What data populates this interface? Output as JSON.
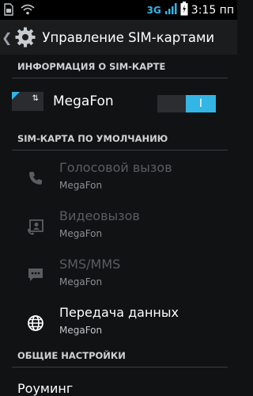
{
  "status_bar": {
    "network_label": "3G",
    "time": "3:15 пп",
    "icons": [
      "sim-icon",
      "wifi-icon",
      "signal-icon",
      "battery-icon"
    ]
  },
  "action_bar": {
    "title": "Управление SIM-картами",
    "icons": [
      "back-caret-icon",
      "gear-icon"
    ]
  },
  "sim_info": {
    "header": "ИНФОРМАЦИЯ О SIM-КАРТЕ",
    "sim_name": "MegaFon",
    "toggle_label": "I",
    "toggle_state": "on"
  },
  "default_sim": {
    "header": "SIM-КАРТА ПО УМОЛЧАНИЮ",
    "items": [
      {
        "title": "Голосовой вызов",
        "subtitle": "MegaFon",
        "icon": "phone-icon",
        "enabled": false
      },
      {
        "title": "Видеовызов",
        "subtitle": "MegaFon",
        "icon": "video-call-icon",
        "enabled": false
      },
      {
        "title": "SMS/MMS",
        "subtitle": "MegaFon",
        "icon": "message-icon",
        "enabled": false
      },
      {
        "title": "Передача данных",
        "subtitle": "MegaFon",
        "icon": "globe-icon",
        "enabled": true
      }
    ]
  },
  "general": {
    "header": "ОБЩИЕ НАСТРОЙКИ",
    "items": [
      {
        "title": "Роуминг"
      }
    ]
  },
  "colors": {
    "accent": "#33b5e5",
    "background": "#101214",
    "disabled_text": "#5a5d61"
  }
}
